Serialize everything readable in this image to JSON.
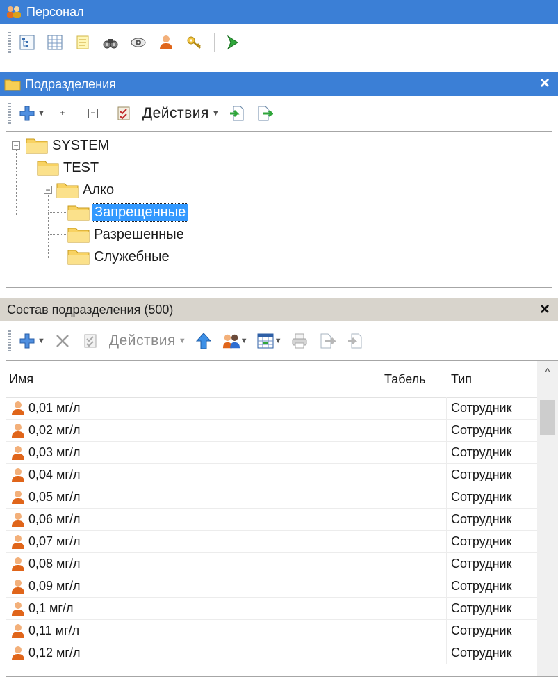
{
  "window": {
    "title": "Персонал",
    "icon": "people-group-icon"
  },
  "main_toolbar": {
    "icons": [
      "tree-view-icon",
      "grid-view-icon",
      "notes-icon",
      "binoculars-icon",
      "eye-icon",
      "person-icon",
      "key-icon",
      "green-arrow-icon"
    ]
  },
  "departments": {
    "title": "Подразделения",
    "close_label": "×",
    "toolbar": {
      "add_icon": "add-plus-icon",
      "expand_label": "+",
      "collapse_label": "−",
      "properties_icon": "properties-icon",
      "actions_label": "Действия",
      "import_icon": "import-icon",
      "export_icon": "export-icon"
    },
    "tree": [
      {
        "label": "SYSTEM",
        "expander": "⊟",
        "selected": false
      },
      {
        "label": "TEST",
        "selected": false
      },
      {
        "label": "Алко",
        "expander": "⊟",
        "selected": false
      },
      {
        "label": "Запрещенные",
        "selected": true
      },
      {
        "label": "Разрешенные",
        "selected": false
      },
      {
        "label": "Служебные",
        "selected": false
      }
    ]
  },
  "members": {
    "title": "Состав подразделения (500)",
    "close_label": "×",
    "toolbar": {
      "add_icon": "add-plus-icon",
      "delete_icon": "delete-x-icon",
      "properties_icon": "properties-icon",
      "actions_label": "Действия",
      "up_icon": "blue-up-arrow-icon",
      "group_icon": "people-group-icon",
      "columns_icon": "table-columns-icon",
      "print_icon": "printer-icon",
      "export_icon": "export-icon",
      "import_icon": "import-icon"
    },
    "columns": {
      "name": "Имя",
      "tab": "Табель",
      "type": "Тип"
    },
    "scroll_up": "^",
    "rows": [
      {
        "name": "0,01 мг/л",
        "tab": "",
        "type": "Сотрудник"
      },
      {
        "name": "0,02 мг/л",
        "tab": "",
        "type": "Сотрудник"
      },
      {
        "name": "0,03 мг/л",
        "tab": "",
        "type": "Сотрудник"
      },
      {
        "name": "0,04 мг/л",
        "tab": "",
        "type": "Сотрудник"
      },
      {
        "name": "0,05 мг/л",
        "tab": "",
        "type": "Сотрудник"
      },
      {
        "name": "0,06 мг/л",
        "tab": "",
        "type": "Сотрудник"
      },
      {
        "name": "0,07 мг/л",
        "tab": "",
        "type": "Сотрудник"
      },
      {
        "name": "0,08 мг/л",
        "tab": "",
        "type": "Сотрудник"
      },
      {
        "name": "0,09 мг/л",
        "tab": "",
        "type": "Сотрудник"
      },
      {
        "name": "0,1 мг/л",
        "tab": "",
        "type": "Сотрудник"
      },
      {
        "name": "0,11 мг/л",
        "tab": "",
        "type": "Сотрудник"
      },
      {
        "name": "0,12 мг/л",
        "tab": "",
        "type": "Сотрудник"
      }
    ]
  },
  "colors": {
    "title_bar": "#3b7fd6",
    "section_header": "#d8d4cc",
    "selection": "#3399ff"
  }
}
